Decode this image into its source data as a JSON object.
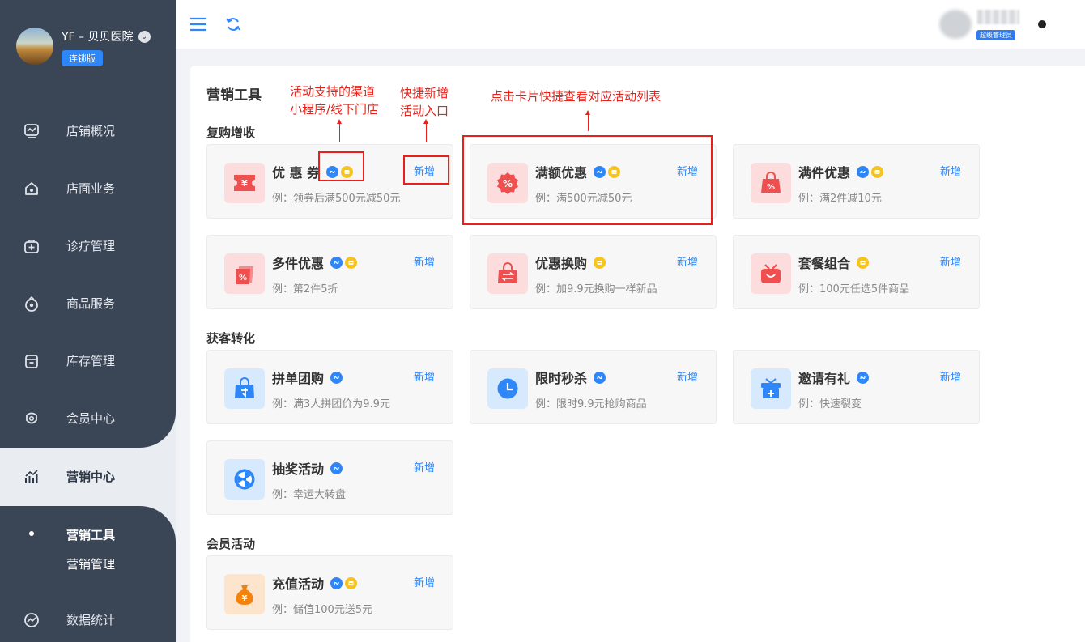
{
  "sidebar": {
    "shop_name": "YF – 贝贝医院",
    "edition": "连锁版",
    "items": [
      {
        "label": "店铺概况",
        "icon": "dashboard-icon"
      },
      {
        "label": "店面业务",
        "icon": "store-home-icon"
      },
      {
        "label": "诊疗管理",
        "icon": "medical-kit-icon"
      },
      {
        "label": "商品服务",
        "icon": "goods-bag-icon"
      },
      {
        "label": "库存管理",
        "icon": "inventory-box-icon"
      },
      {
        "label": "会员中心",
        "icon": "member-icon"
      },
      {
        "label": "营销中心",
        "icon": "marketing-chart-icon",
        "active": true
      },
      {
        "label": "数据统计",
        "icon": "statistics-icon"
      }
    ],
    "sub_items": [
      {
        "label": "营销工具",
        "active": true
      },
      {
        "label": "营销管理"
      }
    ]
  },
  "header": {
    "menu_icon": "hamburger-menu-icon",
    "refresh_icon": "refresh-icon",
    "role_badge": "超级管理员"
  },
  "main": {
    "title": "营销工具",
    "sections": [
      {
        "title": "复购增收",
        "cards": [
          {
            "title": "优 惠 券",
            "desc": "例：领券后满500元减50元",
            "add": "新增",
            "channels": [
              "miniprogram",
              "store"
            ],
            "icon": "coupon-icon"
          },
          {
            "title": "满额优惠",
            "desc": "例：满500元减50元",
            "add": "新增",
            "channels": [
              "miniprogram",
              "store"
            ],
            "icon": "discount-badge-icon"
          },
          {
            "title": "满件优惠",
            "desc": "例：满2件减10元",
            "add": "新增",
            "channels": [
              "miniprogram",
              "store"
            ],
            "icon": "shopping-bag-percent-icon"
          },
          {
            "title": "多件优惠",
            "desc": "例：第2件5折",
            "add": "新增",
            "channels": [
              "miniprogram",
              "store"
            ],
            "icon": "multi-bag-percent-icon"
          },
          {
            "title": "优惠换购",
            "desc": "例：加9.9元换购一样新品",
            "add": "新增",
            "channels": [
              "store"
            ],
            "icon": "exchange-bag-icon"
          },
          {
            "title": "套餐组合",
            "desc": "例：100元任选5件商品",
            "add": "新增",
            "channels": [
              "store"
            ],
            "icon": "gift-combo-icon"
          }
        ]
      },
      {
        "title": "获客转化",
        "cards": [
          {
            "title": "拼单团购",
            "desc": "例：满3人拼团价为9.9元",
            "add": "新增",
            "channels": [
              "miniprogram"
            ],
            "icon": "group-buy-bag-icon"
          },
          {
            "title": "限时秒杀",
            "desc": "例：限时9.9元抢购商品",
            "add": "新增",
            "channels": [
              "miniprogram"
            ],
            "icon": "clock-icon"
          },
          {
            "title": "邀请有礼",
            "desc": "例：快速裂变",
            "add": "新增",
            "channels": [
              "miniprogram"
            ],
            "icon": "gift-box-icon"
          },
          {
            "title": "抽奖活动",
            "desc": "例：幸运大转盘",
            "add": "新增",
            "channels": [
              "miniprogram"
            ],
            "icon": "lucky-wheel-icon"
          }
        ]
      },
      {
        "title": "会员活动",
        "cards": [
          {
            "title": "充值活动",
            "desc": "例：储值100元送5元",
            "add": "新增",
            "channels": [
              "miniprogram",
              "store"
            ],
            "icon": "money-bag-icon"
          }
        ]
      }
    ]
  },
  "annotations": {
    "channels_note_line1": "活动支持的渠道",
    "channels_note_line2": "小程序/线下门店",
    "add_note_line1": "快捷新增",
    "add_note_line2": "活动入口",
    "card_note": "点击卡片快捷查看对应活动列表"
  },
  "colors": {
    "sidebar_bg": "#3a4556",
    "accent_blue": "#2f86f6",
    "annotation_red": "#e8201a",
    "store_badge_yellow": "#f7c41c"
  }
}
